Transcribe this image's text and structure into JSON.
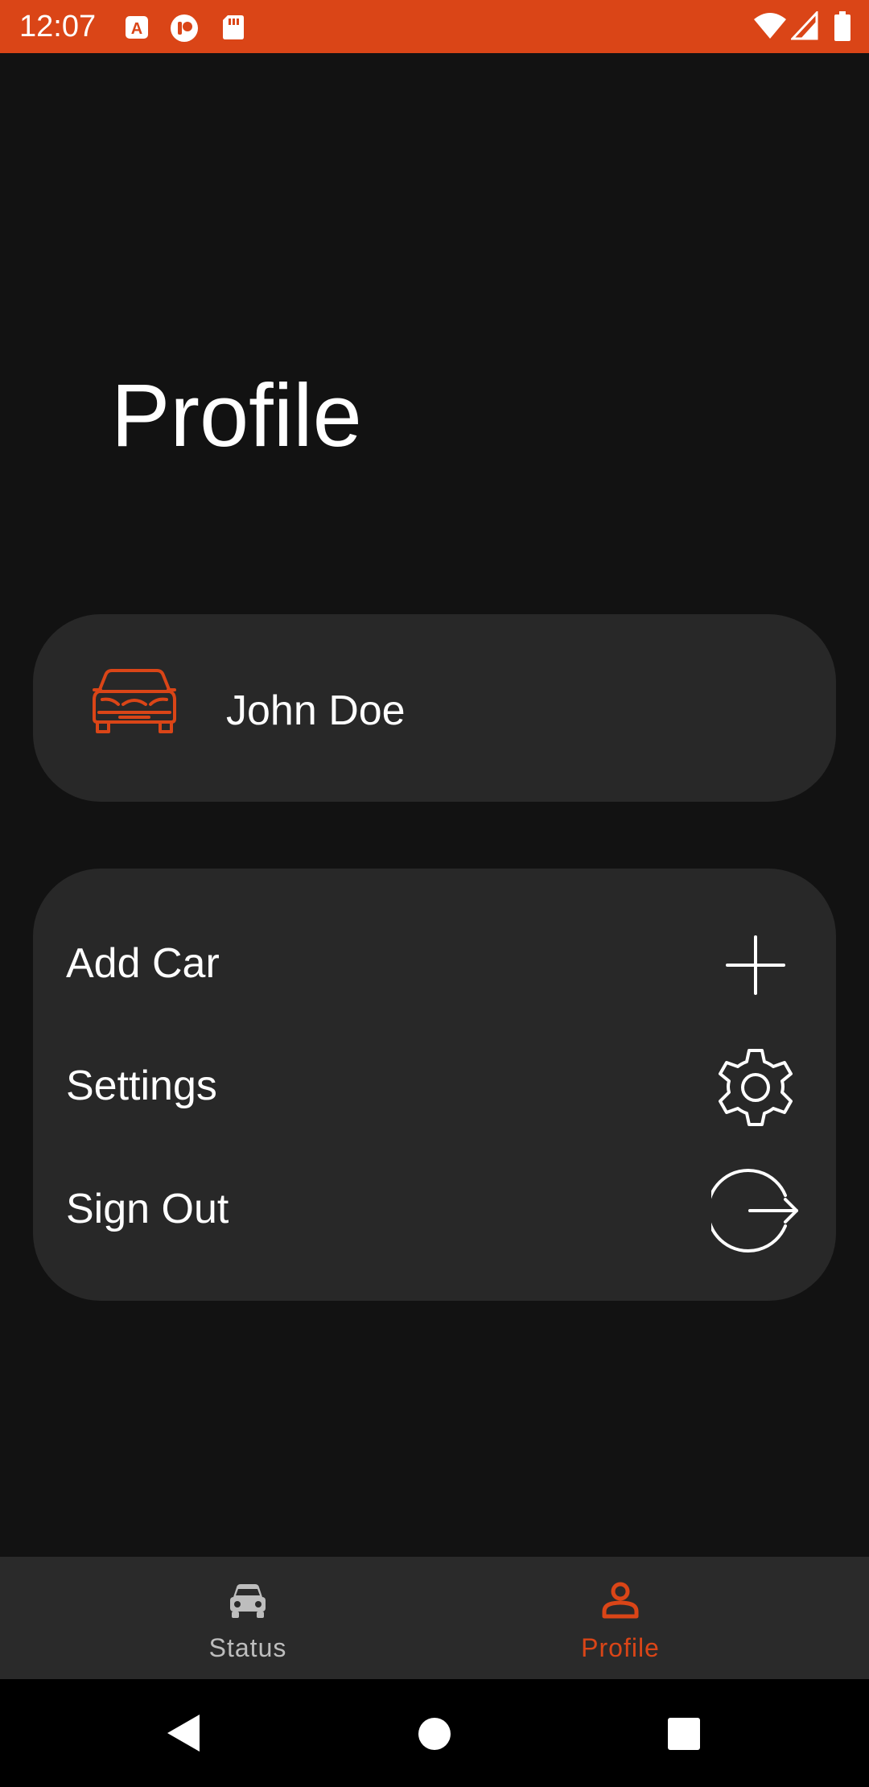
{
  "status_bar": {
    "time": "12:07",
    "background": "#DA4517",
    "notification_icons": [
      "a-app-icon",
      "media-icon",
      "sd-card-icon"
    ],
    "right_icons": [
      "wifi-icon",
      "signal-icon",
      "battery-icon"
    ]
  },
  "page": {
    "title": "Profile"
  },
  "user_card": {
    "icon": "car-icon",
    "name": "John Doe"
  },
  "menu": {
    "items": [
      {
        "label": "Add Car",
        "icon": "plus-icon"
      },
      {
        "label": "Settings",
        "icon": "gear-icon"
      },
      {
        "label": "Sign Out",
        "icon": "sign-out-icon"
      }
    ]
  },
  "bottom_nav": {
    "items": [
      {
        "label": "Status",
        "icon": "car-icon",
        "active": false
      },
      {
        "label": "Profile",
        "icon": "person-icon",
        "active": true
      }
    ]
  },
  "system_nav": {
    "buttons": [
      "back-icon",
      "home-icon",
      "recents-icon"
    ]
  },
  "colors": {
    "accent": "#DA4517",
    "background": "#121212",
    "card": "#282828",
    "nav_background": "#2A2A2A",
    "inactive": "#BDBDBD",
    "text": "#FFFFFF"
  }
}
